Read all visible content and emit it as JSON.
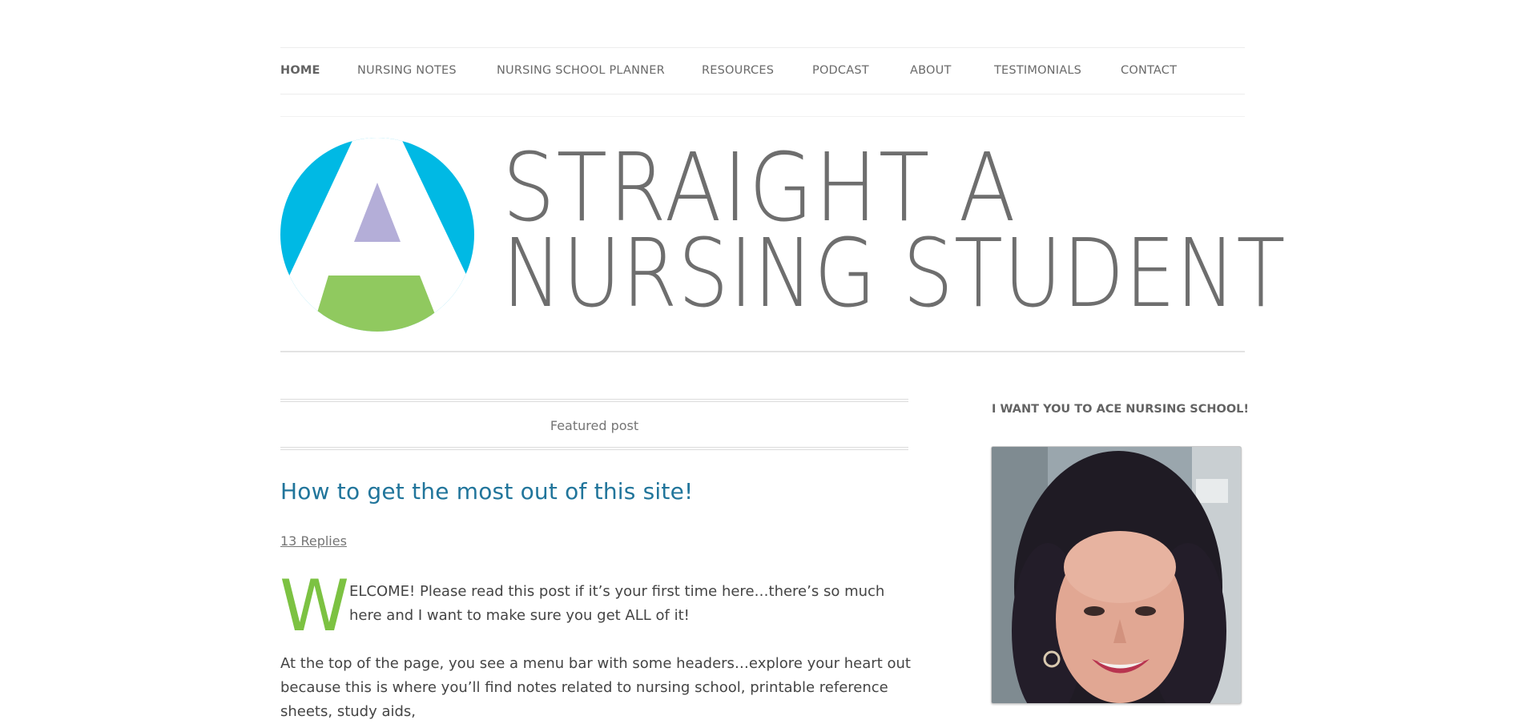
{
  "nav": {
    "items": [
      {
        "label": "HOME",
        "active": true
      },
      {
        "label": "NURSING NOTES"
      },
      {
        "label": "NURSING SCHOOL PLANNER"
      },
      {
        "label": "RESOURCES"
      },
      {
        "label": "PODCAST"
      },
      {
        "label": "ABOUT"
      },
      {
        "label": "TESTIMONIALS"
      },
      {
        "label": "CONTACT"
      }
    ]
  },
  "banner": {
    "line1": "STRAIGHT A",
    "line2": "NURSING STUDENT",
    "logo_colors": {
      "circle": "#00b9e4",
      "triangle": "#b4aed8",
      "base": "#90c95f"
    }
  },
  "main": {
    "featured_label": "Featured post",
    "post_title": "How to get the most out of this site!",
    "replies": "13 Replies",
    "dropcap": "W",
    "first_paragraph": "ELCOME! Please read this post if it’s your first time here…there’s so much here and I want to make sure you get ALL of it!",
    "second_paragraph": "At the top of the page, you see a menu bar with some headers…explore your heart out because this is where you’ll find notes related to nursing school, printable reference sheets, study aids,"
  },
  "sidebar": {
    "widget_title": "I WANT YOU TO ACE NURSING SCHOOL!"
  },
  "colors": {
    "link": "#21759b",
    "dropcap": "#7cc242",
    "text": "#444444"
  }
}
